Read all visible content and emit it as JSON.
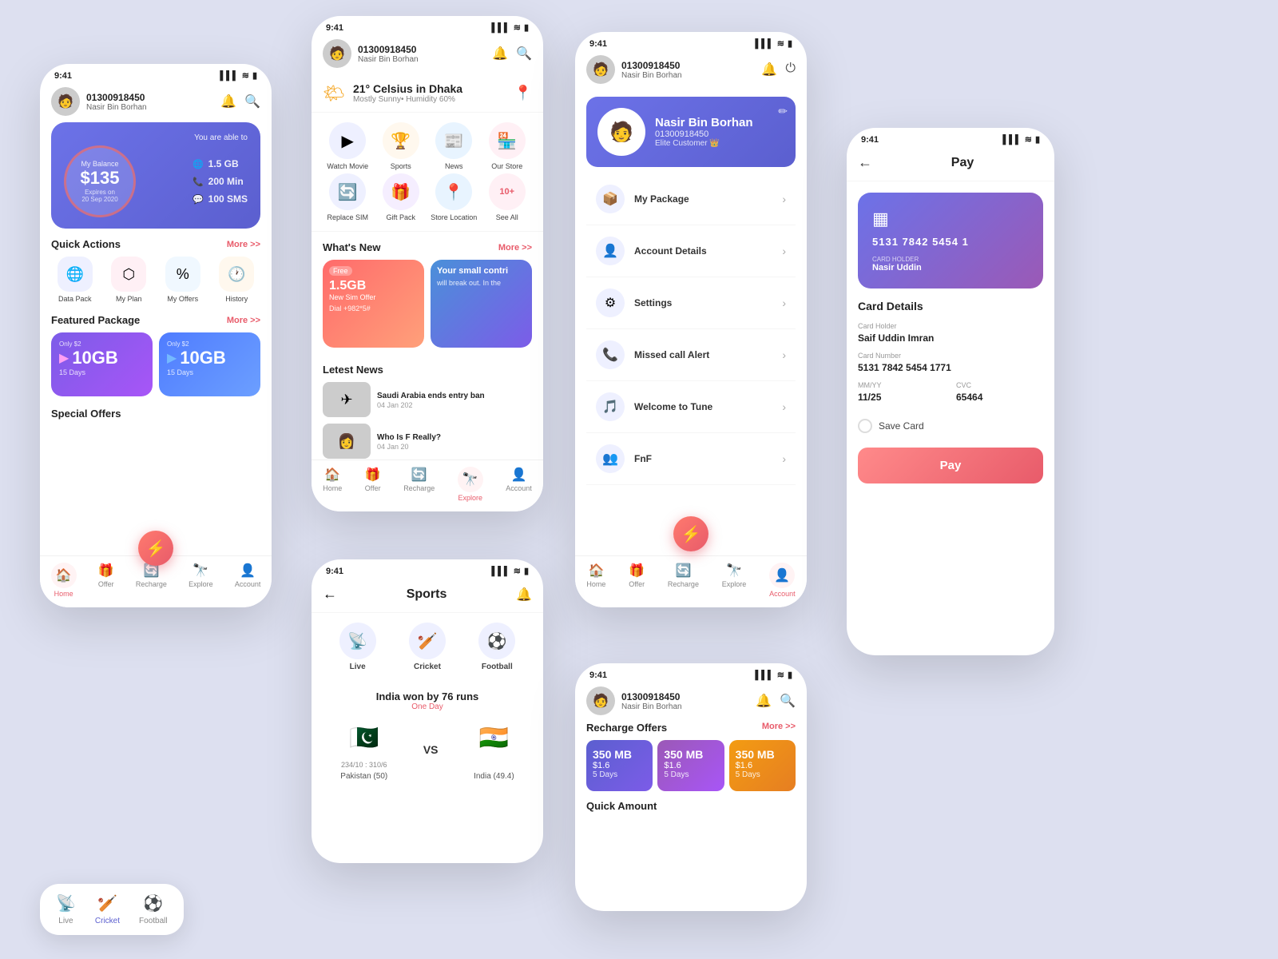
{
  "bg": {
    "color": "#dde0f0"
  },
  "phone1": {
    "status_time": "9:41",
    "phone_number": "01300918450",
    "user_name": "Nasir Bin Borhan",
    "balance_label": "My Balance",
    "balance_amount": "$135",
    "expires_label": "Expires on",
    "expires_date": "20 Sep 2020",
    "you_able": "You are able to",
    "data": "1.5 GB",
    "mins": "200 Min",
    "sms": "100 SMS",
    "quick_actions": "Quick Actions",
    "more": "More >>",
    "qa_items": [
      {
        "label": "Data Pack",
        "icon": "🌐"
      },
      {
        "label": "My Plan",
        "icon": "⬡"
      },
      {
        "label": "My Offers",
        "icon": "%"
      },
      {
        "label": "History",
        "icon": "🕐"
      }
    ],
    "featured_label": "Featured Package",
    "pkg1_only": "Only $2",
    "pkg1_gb": "10GB",
    "pkg1_days": "15 Days",
    "pkg2_only": "Only $2",
    "pkg2_gb": "10GB",
    "pkg2_days": "15 Days",
    "special_offers": "Special Offers",
    "nav": [
      "Home",
      "Offer",
      "Recharge",
      "Explore",
      "Account"
    ]
  },
  "phone2": {
    "status_time": "9:41",
    "phone_number": "01300918450",
    "user_name": "Nasir Bin Borhan",
    "weather_temp": "21° Celsius in Dhaka",
    "weather_sub": "Mostly Sunny• Humidity 60%",
    "grid_items": [
      {
        "label": "Watch Movie",
        "icon": "▶",
        "color": "#5b5fcf"
      },
      {
        "label": "Sports",
        "icon": "🏆",
        "color": "#e8a23e"
      },
      {
        "label": "News",
        "icon": "📰",
        "color": "#4a90d9"
      },
      {
        "label": "Our Store",
        "icon": "🏪",
        "color": "#e85b6a"
      },
      {
        "label": "Replace SIM",
        "icon": "🔄",
        "color": "#5b5fcf"
      },
      {
        "label": "Gift Pack",
        "icon": "🎁",
        "color": "#7c5ce8"
      },
      {
        "label": "Store Location",
        "icon": "📍",
        "color": "#4a90d9"
      },
      {
        "label": "See All",
        "icon": "10+",
        "color": "#e85b6a"
      }
    ],
    "whats_new": "What's New",
    "news_card1_tag": "Free",
    "news_card1_text": "1.5GB\nNew Sim Offer",
    "news_card1_dial": "Dial\n+982*5#",
    "news_card2_text": "Your small contri",
    "news_card2_sub": "will break out. In the",
    "latest_news": "Letest News",
    "news_items": [
      {
        "title": "Saudi Arabia ends entry ban",
        "date": "04 Jan 202",
        "icon": "✈"
      },
      {
        "title": "Who Is F Really?",
        "date": "04 Jan 20",
        "icon": "👩"
      }
    ],
    "nav": [
      "Home",
      "Offer",
      "Recharge",
      "Explore",
      "Account"
    ]
  },
  "phone3": {
    "status_time": "9:41",
    "phone_number": "01300918450",
    "user_name": "Nasir Bin Borhan",
    "banner_name": "Nasir Bin Borhan",
    "banner_phone": "01300918450",
    "banner_badge": "Elite Customer",
    "menu_items": [
      {
        "label": "My Package",
        "icon": "📦"
      },
      {
        "label": "Account Details",
        "icon": "👤"
      },
      {
        "label": "Settings",
        "icon": "⚙"
      },
      {
        "label": "Missed call Alert",
        "icon": "📞"
      },
      {
        "label": "Welcome to Tune",
        "icon": "🎵"
      },
      {
        "label": "FnF",
        "icon": "👥"
      }
    ],
    "nav": [
      "Home",
      "Offer",
      "Recharge",
      "Explore",
      "Account"
    ]
  },
  "phone4": {
    "status_time": "9:41",
    "sports_title": "Sports",
    "tabs": [
      {
        "label": "Live",
        "icon": "📡"
      },
      {
        "label": "Cricket",
        "icon": "🏏"
      },
      {
        "label": "Football",
        "icon": "⚽"
      }
    ],
    "match_title": "India won by 76 runs",
    "match_type": "One Day",
    "team1_flag": "🇵🇰",
    "team1_name": "Pakistan (50)",
    "team1_score": "234/10 : 310/6",
    "team2_flag": "🇮🇳",
    "team2_name": "India (49.4)"
  },
  "phone5": {
    "status_time": "9:41",
    "pay_title": "Pay",
    "card_number": "5131  7842  5454  1",
    "card_holder_label": "CARD HOLDER",
    "card_holder": "Nasir Uddin",
    "card_details_title": "Card Details",
    "holder_label": "Card Holder",
    "holder_value": "Saif Uddin Imran",
    "number_label": "Card Number",
    "number_value": "5131  7842  5454  1771",
    "mmyy_label": "MM/YY",
    "mmyy_value": "11/25",
    "cvc_label": "CVC",
    "cvc_value": "65464",
    "save_card": "Save Card",
    "pay_btn": "Pay"
  },
  "phone6": {
    "status_time": "9:41",
    "phone_number": "01300918450",
    "user_name": "Nasir Bin Borhan",
    "recharge_label": "Recharge Offers",
    "more": "More >>",
    "cards": [
      {
        "mb": "350 MB",
        "price": "$1.6",
        "days": "5 Days",
        "type": "indigo"
      },
      {
        "mb": "350 MB",
        "price": "$1.6",
        "days": "5 Days",
        "type": "purple2"
      },
      {
        "mb": "350 MB",
        "price": "$1.6",
        "days": "5 Days",
        "type": "orange"
      }
    ],
    "quick_amount": "Quick Amount"
  },
  "sports_bottom": {
    "items": [
      {
        "label": "Live",
        "icon": "📡",
        "active": false
      },
      {
        "label": "Cricket",
        "icon": "🏏",
        "active": true
      },
      {
        "label": "Football",
        "icon": "⚽",
        "active": false
      }
    ]
  }
}
